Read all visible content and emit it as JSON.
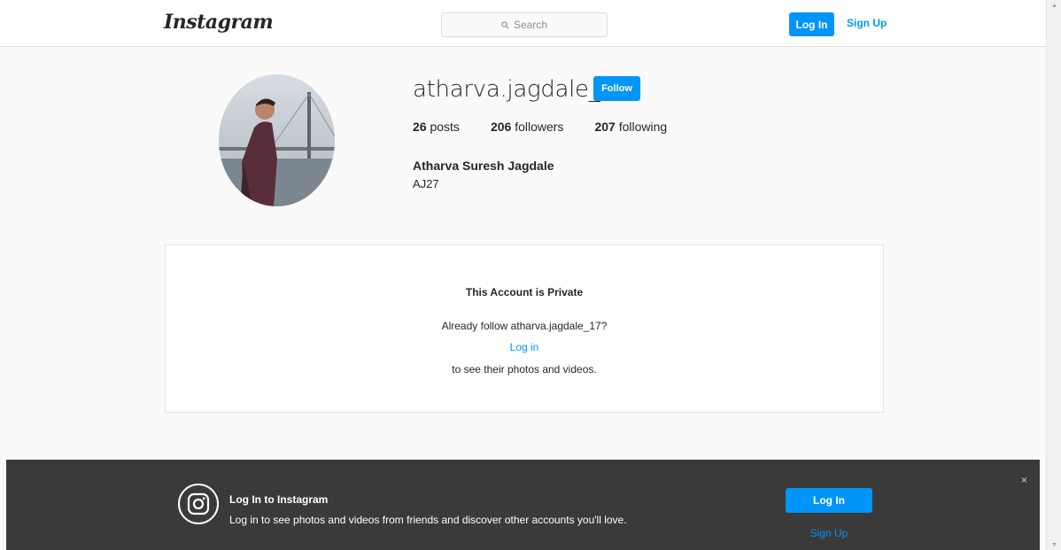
{
  "header": {
    "logo_text": "Instagram",
    "search_placeholder": "Search",
    "login_label": "Log In",
    "signup_label": "Sign Up"
  },
  "profile": {
    "username": "atharva.jagdale_17",
    "follow_label": "Follow",
    "posts_count": "26",
    "posts_label": "posts",
    "followers_count": "206",
    "followers_label": "followers",
    "following_count": "207",
    "following_label": "following",
    "full_name": "Atharva Suresh Jagdale",
    "bio": "AJ27"
  },
  "private_notice": {
    "title": "This Account is Private",
    "line1": "Already follow atharva.jagdale_17?",
    "login_link": "Log in",
    "line2": "to see their photos and videos."
  },
  "banner": {
    "title": "Log In to Instagram",
    "text": "Log in to see photos and videos from friends and discover other accounts you'll love.",
    "login_label": "Log In",
    "signup_label": "Sign Up",
    "close_symbol": "×"
  },
  "colors": {
    "accent": "#0095f6",
    "banner_bg": "#3a3a3a"
  }
}
